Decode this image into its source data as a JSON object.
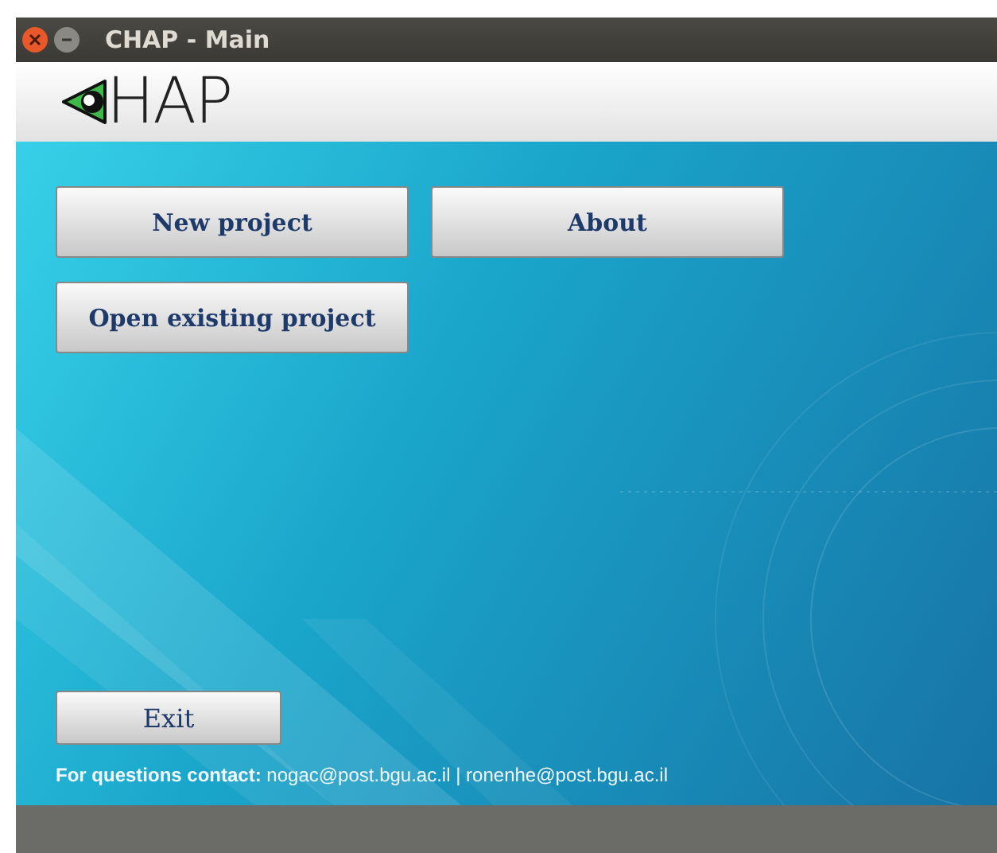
{
  "window": {
    "title": "CHAP - Main"
  },
  "logo": {
    "text": "HAP"
  },
  "buttons": [
    {
      "label": "New project"
    },
    {
      "label": "About"
    },
    {
      "label": "Open existing project"
    }
  ],
  "exit_button": {
    "label": "Exit"
  },
  "contact": "**For questions contact:** nogac@post.bgu.ac.il | ronenhe@post.bgu.ac.il"
}
